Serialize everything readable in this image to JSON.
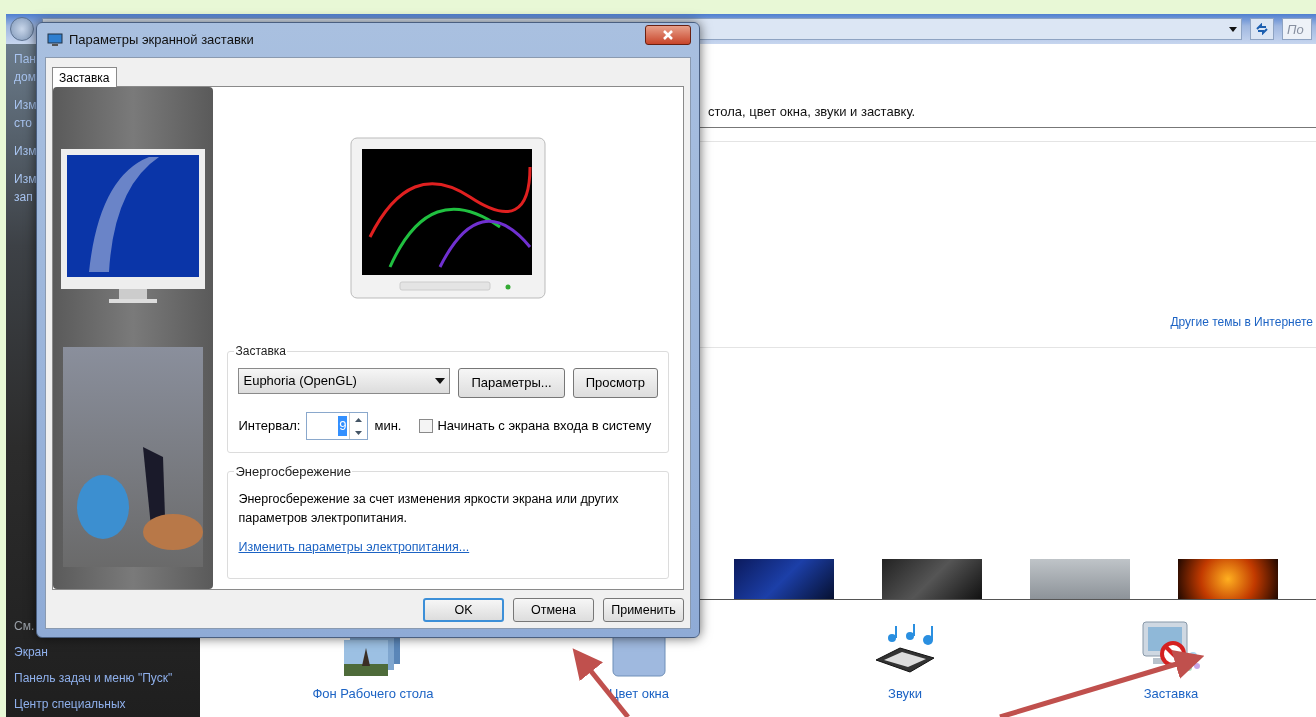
{
  "explorer": {
    "search": {
      "placeholder": "По"
    },
    "sidebar": {
      "links_top": [
        {
          "lines": [
            "Пан",
            "дом"
          ]
        },
        {
          "lines": [
            "Изм",
            "сто"
          ]
        },
        {
          "lines": [
            "Изм"
          ]
        },
        {
          "lines": [
            "Изм",
            "зап"
          ]
        }
      ],
      "see_also": "См.",
      "links_bottom": [
        "Экран",
        "Панель задач и меню \"Пуск\"",
        "Центр специальных"
      ]
    },
    "description": "стола, цвет окна, звуки и заставку.",
    "online_themes_link": "Другие темы в Интернете",
    "bottom_items": [
      {
        "kind": "wallpaper",
        "label": "Фон Рабочего стола"
      },
      {
        "kind": "window_color",
        "label": "Цвет окна"
      },
      {
        "kind": "sounds",
        "label": "Звуки"
      },
      {
        "kind": "screensaver",
        "label": "Заставка"
      }
    ]
  },
  "dialog": {
    "title": "Параметры экранной заставки",
    "tabs": [
      {
        "label": "Заставка",
        "selected": true
      }
    ],
    "screensaver_group": {
      "title": "Заставка",
      "dropdown_value": "Euphoria (OpenGL)",
      "buttons": [
        "Параметры...",
        "Просмотр"
      ],
      "interval_label": "Интервал:",
      "interval_value": "9",
      "interval_unit": "мин.",
      "logon_checkbox": {
        "label": "Начинать с экрана входа в систему",
        "checked": false
      }
    },
    "power_group": {
      "title": "Энергосбережение",
      "text": "Энергосбережение за счет изменения яркости экрана или других параметров электропитания.",
      "link": "Изменить параметры электропитания..."
    },
    "footer_buttons": [
      {
        "label": "OK",
        "default": true
      },
      {
        "label": "Отмена",
        "default": false
      },
      {
        "label": "Применить",
        "default": false
      }
    ]
  }
}
